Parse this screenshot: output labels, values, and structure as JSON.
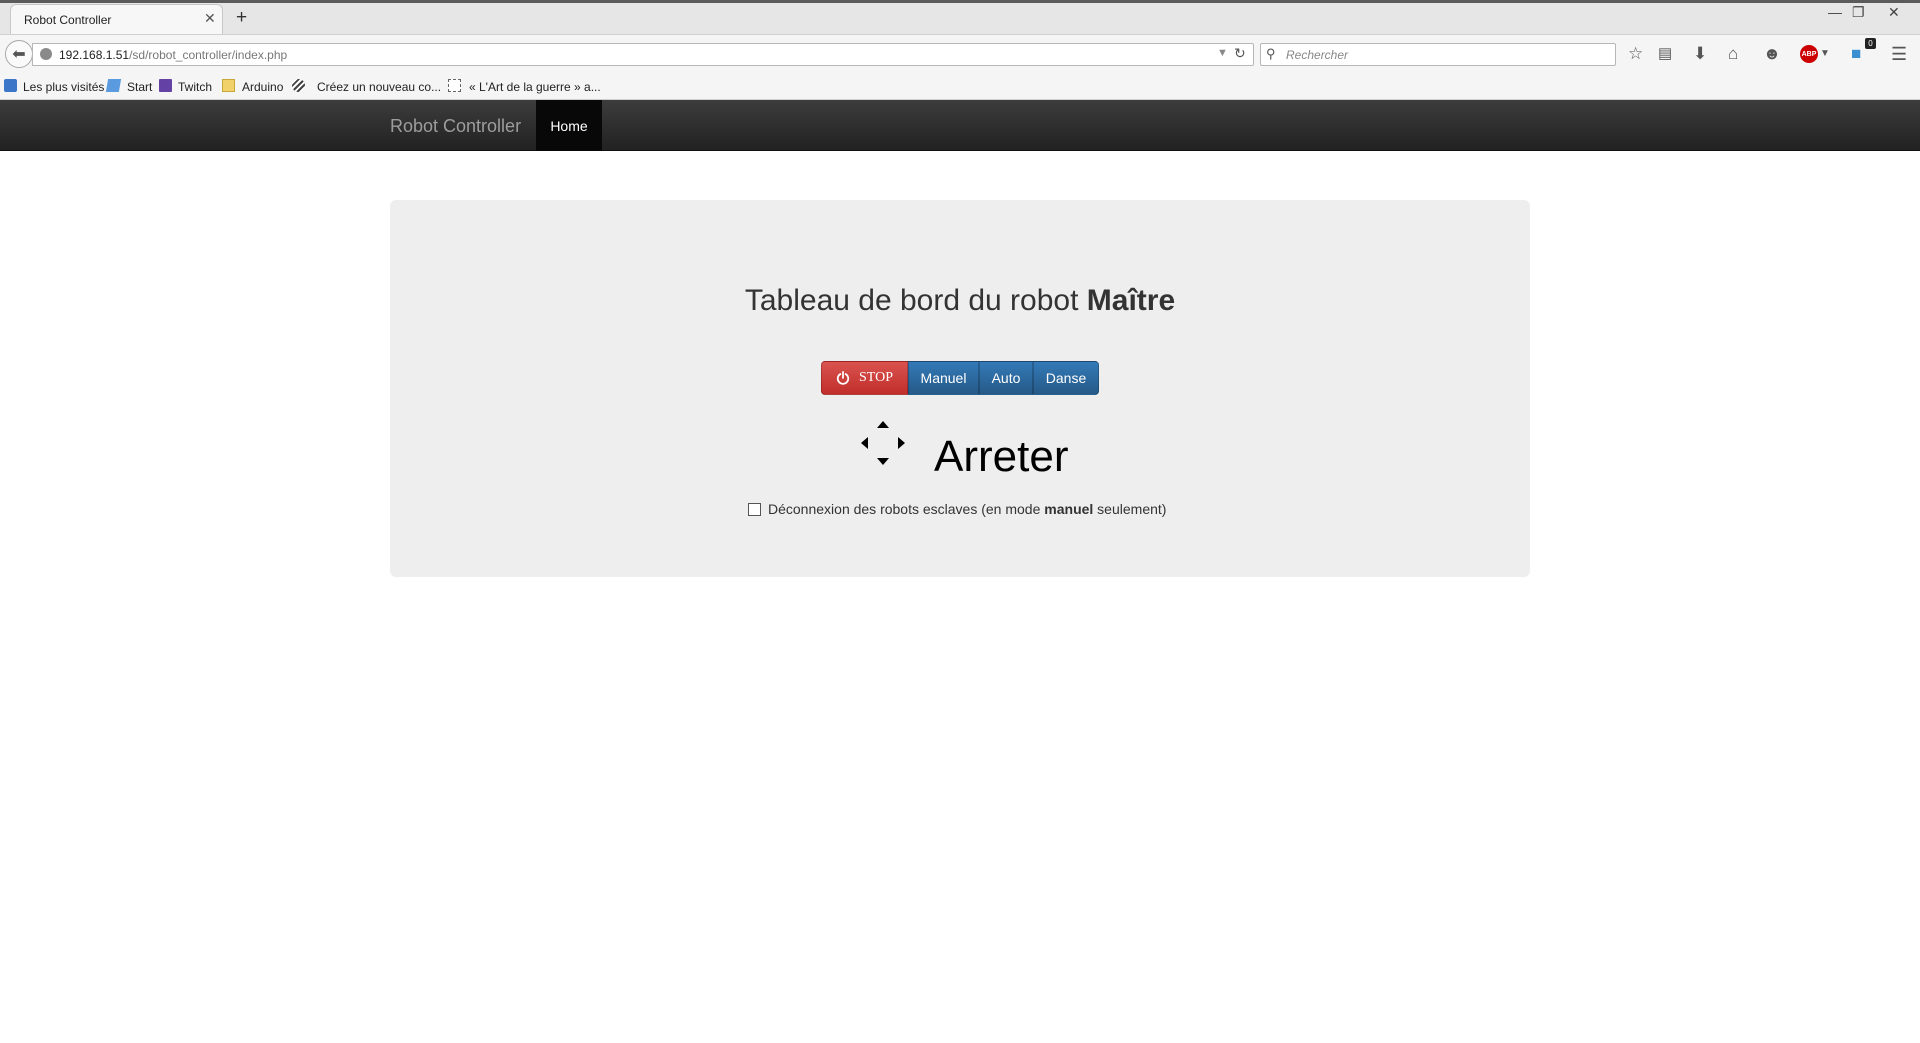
{
  "browser": {
    "tab_title": "Robot Controller",
    "tab_close": "✕",
    "new_tab": "+",
    "url_host": "192.168.1.51",
    "url_path": "/sd/robot_controller/index.php",
    "search_placeholder": "Rechercher",
    "window_minimize": "—",
    "window_restore": "❐",
    "window_close": "✕",
    "notification_count": "0",
    "abp_label": "ABP",
    "bookmarks": [
      {
        "label": "Les plus visités",
        "icon": "most-visited-icon"
      },
      {
        "label": "Start",
        "icon": "start-icon"
      },
      {
        "label": "Twitch",
        "icon": "twitch-icon"
      },
      {
        "label": "Arduino",
        "icon": "folder-icon"
      },
      {
        "label": "Créez un nouveau co...",
        "icon": "site-icon"
      },
      {
        "label": "« L'Art de la guerre » a...",
        "icon": "blank-page-icon"
      }
    ]
  },
  "app": {
    "brand": "Robot Controller",
    "nav_home": "Home",
    "title_prefix": "Tableau de bord du robot ",
    "title_bold": "Maître",
    "buttons": {
      "stop": "STOP",
      "manuel": "Manuel",
      "auto": "Auto",
      "danse": "Danse"
    },
    "state": "Arreter",
    "checkbox_prefix": "Déconnexion des robots esclaves (en mode ",
    "checkbox_bold": "manuel",
    "checkbox_suffix": " seulement)",
    "checkbox_checked": false
  },
  "colors": {
    "navbar": "#222222",
    "stop_red": "#d9534f",
    "mode_blue": "#337ab7",
    "jumbotron": "#eeeeee"
  }
}
